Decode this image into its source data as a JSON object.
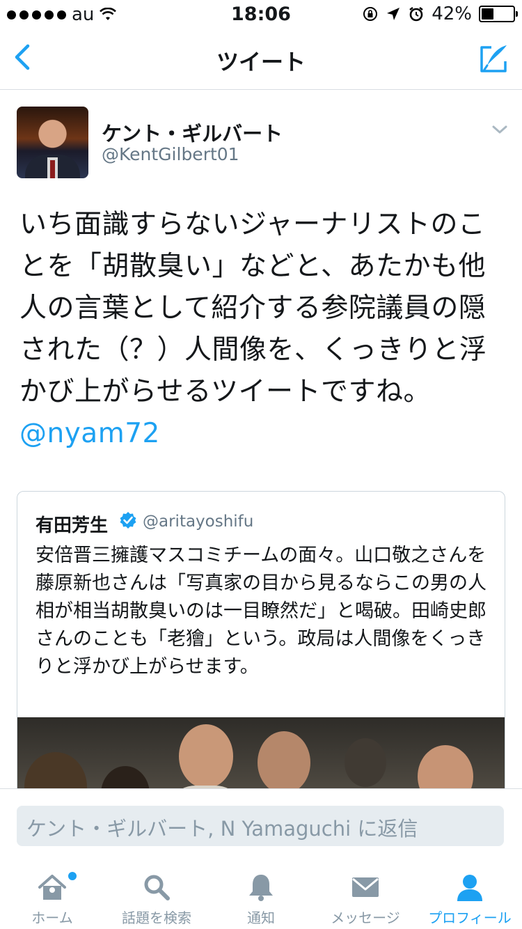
{
  "status_bar": {
    "carrier": "au",
    "time": "18:06",
    "battery": "42%",
    "battery_level": 0.42
  },
  "nav": {
    "title": "ツイート",
    "back_icon": "chevron-left-icon",
    "compose_icon": "compose-tweet-icon"
  },
  "tweet": {
    "author_name": "ケント・ギルバート",
    "author_handle": "@KentGilbert01",
    "text": "いち面識すらないジャーナリストのことを「胡散臭い」などと、あたかも他人の言葉として紹介する参院議員の隠された（？）人間像を、くっきりと浮かび上がらせるツイートですね。",
    "mention": "@nyam72"
  },
  "quoted_tweet": {
    "author_name": "有田芳生",
    "author_handle": "@aritayoshifu",
    "verified": true,
    "text": "安倍晋三擁護マスコミチームの面々。山口敬之さんを藤原新也さんは「写真家の目から見るならこの男の人相が相当胡散臭いのは一目瞭然だ」と喝破。田崎史郎さんのことも「老獪」という。政局は人間像をくっきりと浮かび上がらせます。"
  },
  "reply": {
    "placeholder": "ケント・ギルバート, N Yamaguchi に返信"
  },
  "tabs": [
    {
      "label": "ホーム",
      "icon": "home-icon",
      "active": false,
      "badge": true
    },
    {
      "label": "話題を検索",
      "icon": "search-icon",
      "active": false
    },
    {
      "label": "通知",
      "icon": "bell-icon",
      "active": false
    },
    {
      "label": "メッセージ",
      "icon": "envelope-icon",
      "active": false
    },
    {
      "label": "プロフィール",
      "icon": "person-icon",
      "active": true
    }
  ],
  "colors": {
    "accent": "#1da1f2",
    "muted": "#8899a6"
  }
}
